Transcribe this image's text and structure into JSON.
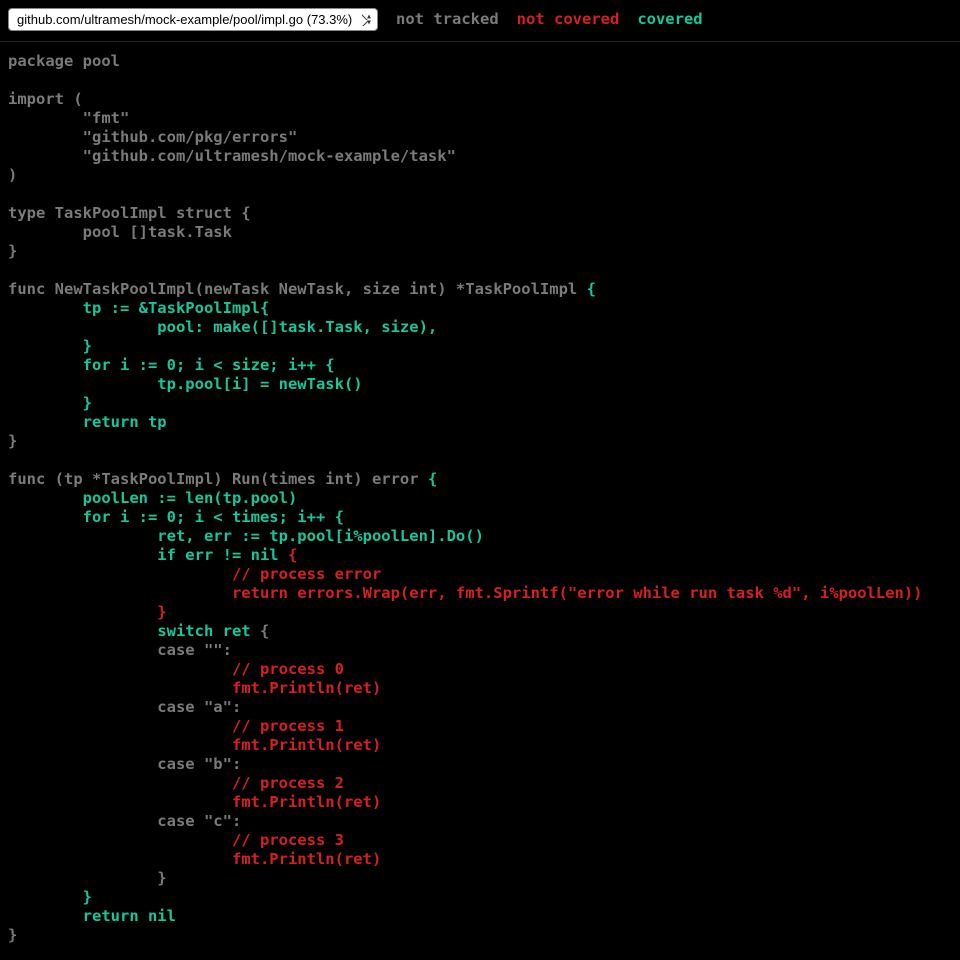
{
  "topbar": {
    "file_selected": "github.com/ultramesh/mock-example/pool/impl.go (73.3%)",
    "legend_not_tracked": "not tracked",
    "legend_not_covered": "not covered",
    "legend_covered": "covered"
  },
  "code": {
    "lines": [
      {
        "segments": [
          {
            "cls": "nt",
            "text": "package pool"
          }
        ]
      },
      {
        "segments": [
          {
            "cls": "nt",
            "text": ""
          }
        ]
      },
      {
        "segments": [
          {
            "cls": "nt",
            "text": "import ("
          }
        ]
      },
      {
        "segments": [
          {
            "cls": "nt",
            "text": "        \"fmt\""
          }
        ]
      },
      {
        "segments": [
          {
            "cls": "nt",
            "text": "        \"github.com/pkg/errors\""
          }
        ]
      },
      {
        "segments": [
          {
            "cls": "nt",
            "text": "        \"github.com/ultramesh/mock-example/task\""
          }
        ]
      },
      {
        "segments": [
          {
            "cls": "nt",
            "text": ")"
          }
        ]
      },
      {
        "segments": [
          {
            "cls": "nt",
            "text": ""
          }
        ]
      },
      {
        "segments": [
          {
            "cls": "nt",
            "text": "type TaskPoolImpl struct {"
          }
        ]
      },
      {
        "segments": [
          {
            "cls": "nt",
            "text": "        pool []task.Task"
          }
        ]
      },
      {
        "segments": [
          {
            "cls": "nt",
            "text": "}"
          }
        ]
      },
      {
        "segments": [
          {
            "cls": "nt",
            "text": ""
          }
        ]
      },
      {
        "segments": [
          {
            "cls": "nt",
            "text": "func NewTaskPoolImpl(newTask NewTask, size int) *TaskPoolImpl "
          },
          {
            "cls": "cv",
            "text": "{"
          }
        ]
      },
      {
        "segments": [
          {
            "cls": "cv",
            "text": "        tp := &TaskPoolImpl{"
          }
        ]
      },
      {
        "segments": [
          {
            "cls": "cv",
            "text": "                pool: make([]task.Task, size),"
          }
        ]
      },
      {
        "segments": [
          {
            "cls": "cv",
            "text": "        }"
          }
        ]
      },
      {
        "segments": [
          {
            "cls": "cv",
            "text": "        for i := 0; i < size; i++ "
          },
          {
            "cls": "cv",
            "text": "{"
          }
        ]
      },
      {
        "segments": [
          {
            "cls": "cv",
            "text": "                tp.pool[i] = newTask()"
          }
        ]
      },
      {
        "segments": [
          {
            "cls": "cv",
            "text": "        }"
          }
        ]
      },
      {
        "segments": [
          {
            "cls": "cv",
            "text": "        return tp"
          }
        ]
      },
      {
        "segments": [
          {
            "cls": "nt",
            "text": "}"
          }
        ]
      },
      {
        "segments": [
          {
            "cls": "nt",
            "text": ""
          }
        ]
      },
      {
        "segments": [
          {
            "cls": "nt",
            "text": "func (tp *TaskPoolImpl) Run(times int) error "
          },
          {
            "cls": "cv",
            "text": "{"
          }
        ]
      },
      {
        "segments": [
          {
            "cls": "cv",
            "text": "        poolLen := len(tp.pool)"
          }
        ]
      },
      {
        "segments": [
          {
            "cls": "cv",
            "text": "        for i := 0; i < times; i++ "
          },
          {
            "cls": "cv",
            "text": "{"
          }
        ]
      },
      {
        "segments": [
          {
            "cls": "cv",
            "text": "                ret, err := tp.pool[i%poolLen].Do()"
          }
        ]
      },
      {
        "segments": [
          {
            "cls": "cv",
            "text": "                if err != nil "
          },
          {
            "cls": "nc",
            "text": "{"
          }
        ]
      },
      {
        "segments": [
          {
            "cls": "nc",
            "text": "                        // process error"
          }
        ]
      },
      {
        "segments": [
          {
            "cls": "nc",
            "text": "                        return errors.Wrap(err, fmt.Sprintf(\"error while run task %d\", i%poolLen))"
          }
        ]
      },
      {
        "segments": [
          {
            "cls": "nc",
            "text": "                }"
          }
        ]
      },
      {
        "segments": [
          {
            "cls": "nt",
            "text": "                "
          },
          {
            "cls": "cv",
            "text": "switch ret "
          },
          {
            "cls": "nt",
            "text": "{"
          }
        ]
      },
      {
        "segments": [
          {
            "cls": "nt",
            "text": "                case \"\":"
          }
        ]
      },
      {
        "segments": [
          {
            "cls": "nc",
            "text": "                        // process 0"
          }
        ]
      },
      {
        "segments": [
          {
            "cls": "nc",
            "text": "                        fmt.Println(ret)"
          }
        ]
      },
      {
        "segments": [
          {
            "cls": "nt",
            "text": "                case \"a\":"
          }
        ]
      },
      {
        "segments": [
          {
            "cls": "nc",
            "text": "                        // process 1"
          }
        ]
      },
      {
        "segments": [
          {
            "cls": "nc",
            "text": "                        fmt.Println(ret)"
          }
        ]
      },
      {
        "segments": [
          {
            "cls": "nt",
            "text": "                case \"b\":"
          }
        ]
      },
      {
        "segments": [
          {
            "cls": "nc",
            "text": "                        // process 2"
          }
        ]
      },
      {
        "segments": [
          {
            "cls": "nc",
            "text": "                        fmt.Println(ret)"
          }
        ]
      },
      {
        "segments": [
          {
            "cls": "nt",
            "text": "                case \"c\":"
          }
        ]
      },
      {
        "segments": [
          {
            "cls": "nc",
            "text": "                        // process 3"
          }
        ]
      },
      {
        "segments": [
          {
            "cls": "nc",
            "text": "                        fmt.Println(ret)"
          }
        ]
      },
      {
        "segments": [
          {
            "cls": "nt",
            "text": "                }"
          }
        ]
      },
      {
        "segments": [
          {
            "cls": "cv",
            "text": "        }"
          }
        ]
      },
      {
        "segments": [
          {
            "cls": "cv",
            "text": "        return nil"
          }
        ]
      },
      {
        "segments": [
          {
            "cls": "nt",
            "text": "}"
          }
        ]
      }
    ]
  }
}
